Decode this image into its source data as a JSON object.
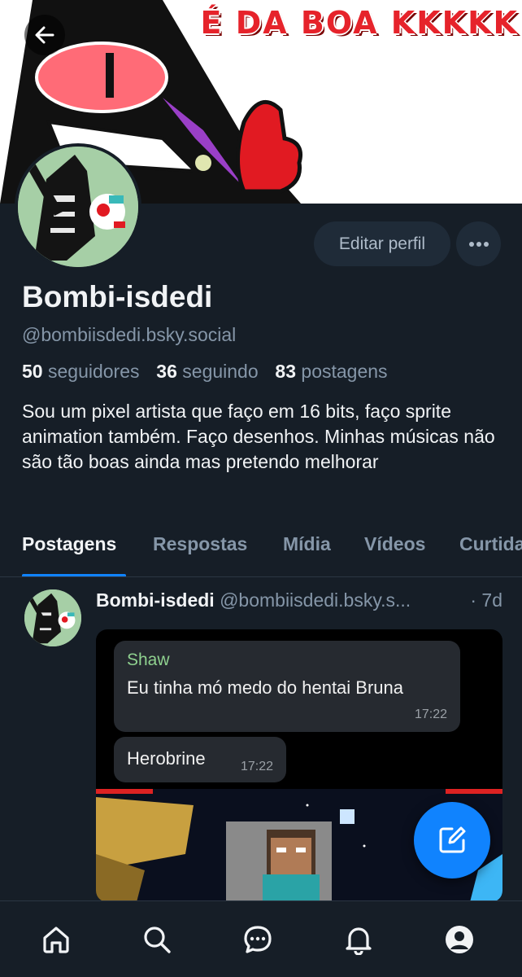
{
  "banner": {
    "caption": "É DA BOA KKKKK"
  },
  "profile": {
    "display_name": "Bombi-isdedi",
    "handle": "@bombiisdedi.bsky.social",
    "followers_count": "50",
    "followers_label": "seguidores",
    "following_count": "36",
    "following_label": "seguindo",
    "posts_count": "83",
    "posts_label": "postagens",
    "bio": "Sou um pixel artista que faço em 16 bits, faço sprite animation também. Faço desenhos. Minhas músicas não são tão boas ainda mas pretendo melhorar"
  },
  "actions": {
    "edit_label": "Editar perfil",
    "more_label": "···"
  },
  "tabs": [
    {
      "label": "Postagens",
      "active": true
    },
    {
      "label": "Respostas",
      "active": false
    },
    {
      "label": "Mídia",
      "active": false
    },
    {
      "label": "Vídeos",
      "active": false
    },
    {
      "label": "Curtidas",
      "active": false
    }
  ],
  "post": {
    "author_name": "Bombi-isdedi",
    "author_handle": "@bombiisdedi.bsky.s...",
    "time": "· 7d",
    "image": {
      "message1_sender": "Shaw",
      "message1_text": "Eu tinha mó medo do hentai Bruna",
      "message1_time": "17:22",
      "message2_text": "Herobrine",
      "message2_time": "17:22"
    }
  },
  "bottom_nav": [
    {
      "name": "home-icon"
    },
    {
      "name": "search-icon"
    },
    {
      "name": "chat-icon"
    },
    {
      "name": "bell-icon"
    },
    {
      "name": "profile-icon"
    }
  ],
  "colors": {
    "background": "#161e27",
    "accent": "#1083fe",
    "muted_text": "#8596a8",
    "banner_text": "#e6232b"
  }
}
